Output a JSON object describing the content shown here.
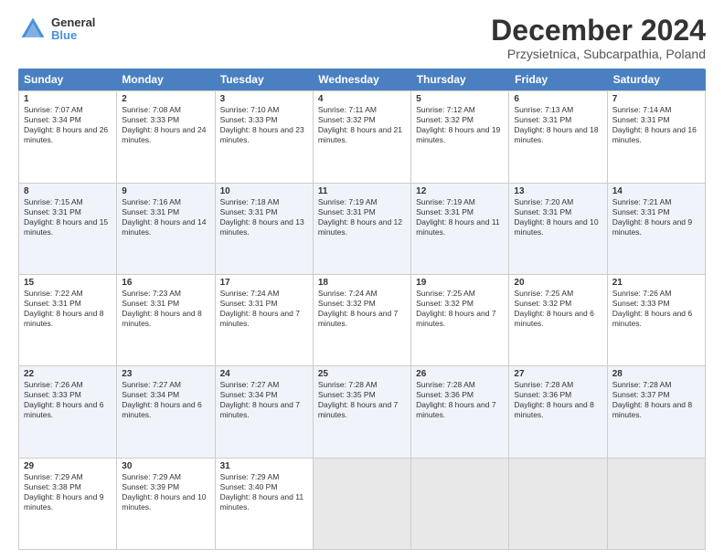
{
  "logo": {
    "line1": "General",
    "line2": "Blue"
  },
  "title": "December 2024",
  "subtitle": "Przysietnica, Subcarpathia, Poland",
  "days": [
    "Sunday",
    "Monday",
    "Tuesday",
    "Wednesday",
    "Thursday",
    "Friday",
    "Saturday"
  ],
  "weeks": [
    [
      {
        "day": "1",
        "sunrise": "7:07 AM",
        "sunset": "3:34 PM",
        "daylight": "8 hours and 26 minutes."
      },
      {
        "day": "2",
        "sunrise": "7:08 AM",
        "sunset": "3:33 PM",
        "daylight": "8 hours and 24 minutes."
      },
      {
        "day": "3",
        "sunrise": "7:10 AM",
        "sunset": "3:33 PM",
        "daylight": "8 hours and 23 minutes."
      },
      {
        "day": "4",
        "sunrise": "7:11 AM",
        "sunset": "3:32 PM",
        "daylight": "8 hours and 21 minutes."
      },
      {
        "day": "5",
        "sunrise": "7:12 AM",
        "sunset": "3:32 PM",
        "daylight": "8 hours and 19 minutes."
      },
      {
        "day": "6",
        "sunrise": "7:13 AM",
        "sunset": "3:31 PM",
        "daylight": "8 hours and 18 minutes."
      },
      {
        "day": "7",
        "sunrise": "7:14 AM",
        "sunset": "3:31 PM",
        "daylight": "8 hours and 16 minutes."
      }
    ],
    [
      {
        "day": "8",
        "sunrise": "7:15 AM",
        "sunset": "3:31 PM",
        "daylight": "8 hours and 15 minutes."
      },
      {
        "day": "9",
        "sunrise": "7:16 AM",
        "sunset": "3:31 PM",
        "daylight": "8 hours and 14 minutes."
      },
      {
        "day": "10",
        "sunrise": "7:18 AM",
        "sunset": "3:31 PM",
        "daylight": "8 hours and 13 minutes."
      },
      {
        "day": "11",
        "sunrise": "7:19 AM",
        "sunset": "3:31 PM",
        "daylight": "8 hours and 12 minutes."
      },
      {
        "day": "12",
        "sunrise": "7:19 AM",
        "sunset": "3:31 PM",
        "daylight": "8 hours and 11 minutes."
      },
      {
        "day": "13",
        "sunrise": "7:20 AM",
        "sunset": "3:31 PM",
        "daylight": "8 hours and 10 minutes."
      },
      {
        "day": "14",
        "sunrise": "7:21 AM",
        "sunset": "3:31 PM",
        "daylight": "8 hours and 9 minutes."
      }
    ],
    [
      {
        "day": "15",
        "sunrise": "7:22 AM",
        "sunset": "3:31 PM",
        "daylight": "8 hours and 8 minutes."
      },
      {
        "day": "16",
        "sunrise": "7:23 AM",
        "sunset": "3:31 PM",
        "daylight": "8 hours and 8 minutes."
      },
      {
        "day": "17",
        "sunrise": "7:24 AM",
        "sunset": "3:31 PM",
        "daylight": "8 hours and 7 minutes."
      },
      {
        "day": "18",
        "sunrise": "7:24 AM",
        "sunset": "3:32 PM",
        "daylight": "8 hours and 7 minutes."
      },
      {
        "day": "19",
        "sunrise": "7:25 AM",
        "sunset": "3:32 PM",
        "daylight": "8 hours and 7 minutes."
      },
      {
        "day": "20",
        "sunrise": "7:25 AM",
        "sunset": "3:32 PM",
        "daylight": "8 hours and 6 minutes."
      },
      {
        "day": "21",
        "sunrise": "7:26 AM",
        "sunset": "3:33 PM",
        "daylight": "8 hours and 6 minutes."
      }
    ],
    [
      {
        "day": "22",
        "sunrise": "7:26 AM",
        "sunset": "3:33 PM",
        "daylight": "8 hours and 6 minutes."
      },
      {
        "day": "23",
        "sunrise": "7:27 AM",
        "sunset": "3:34 PM",
        "daylight": "8 hours and 6 minutes."
      },
      {
        "day": "24",
        "sunrise": "7:27 AM",
        "sunset": "3:34 PM",
        "daylight": "8 hours and 7 minutes."
      },
      {
        "day": "25",
        "sunrise": "7:28 AM",
        "sunset": "3:35 PM",
        "daylight": "8 hours and 7 minutes."
      },
      {
        "day": "26",
        "sunrise": "7:28 AM",
        "sunset": "3:36 PM",
        "daylight": "8 hours and 7 minutes."
      },
      {
        "day": "27",
        "sunrise": "7:28 AM",
        "sunset": "3:36 PM",
        "daylight": "8 hours and 8 minutes."
      },
      {
        "day": "28",
        "sunrise": "7:28 AM",
        "sunset": "3:37 PM",
        "daylight": "8 hours and 8 minutes."
      }
    ],
    [
      {
        "day": "29",
        "sunrise": "7:29 AM",
        "sunset": "3:38 PM",
        "daylight": "8 hours and 9 minutes."
      },
      {
        "day": "30",
        "sunrise": "7:29 AM",
        "sunset": "3:39 PM",
        "daylight": "8 hours and 10 minutes."
      },
      {
        "day": "31",
        "sunrise": "7:29 AM",
        "sunset": "3:40 PM",
        "daylight": "8 hours and 11 minutes."
      },
      null,
      null,
      null,
      null
    ]
  ]
}
